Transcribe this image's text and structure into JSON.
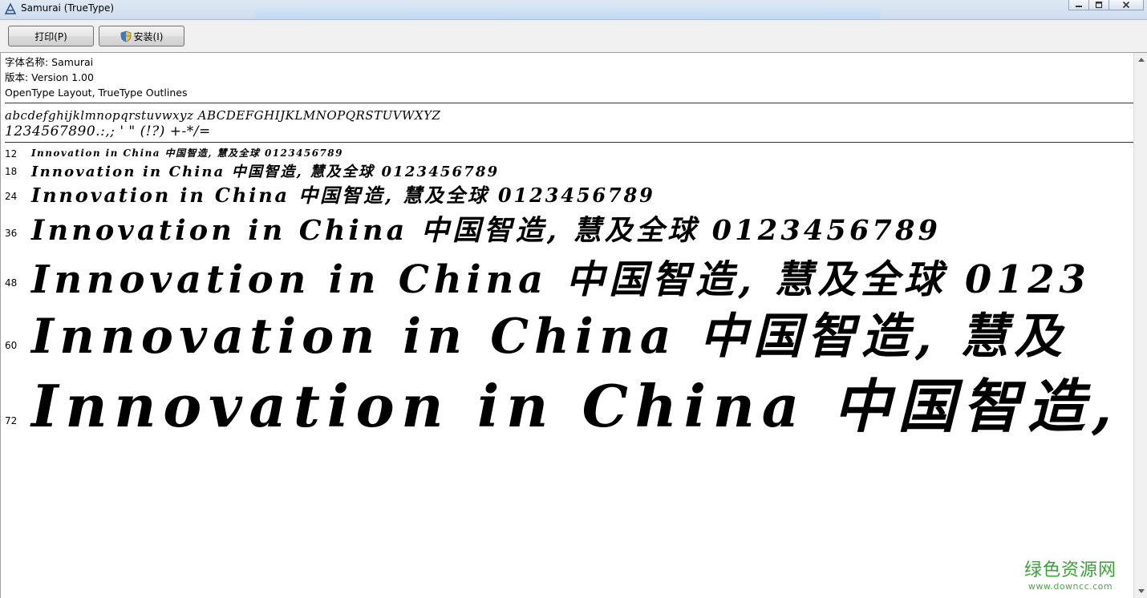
{
  "window": {
    "title": "Samurai (TrueType)"
  },
  "toolbar": {
    "print_label": "打印(P)",
    "install_label": "安装(I)"
  },
  "font_info": {
    "name_line": "字体名称: Samurai",
    "version_line": "版本: Version 1.00",
    "type_line": "OpenType Layout, TrueType Outlines"
  },
  "charset": {
    "line1": "abcdefghijklmnopqrstuvwxyz ABCDEFGHIJKLMNOPQRSTUVWXYZ",
    "line2": "1234567890.:,; ' \" (!?) +-*/="
  },
  "samples": [
    {
      "size": "12",
      "text": "Innovation in China 中国智造, 慧及全球 0123456789"
    },
    {
      "size": "18",
      "text": "Innovation in China 中国智造, 慧及全球 0123456789"
    },
    {
      "size": "24",
      "text": "Innovation in China 中国智造, 慧及全球 0123456789"
    },
    {
      "size": "36",
      "text": "Innovation in China 中国智造, 慧及全球 0123456789"
    },
    {
      "size": "48",
      "text": "Innovation in China 中国智造, 慧及全球 0123"
    },
    {
      "size": "60",
      "text": "Innovation in China 中国智造, 慧及"
    },
    {
      "size": "72",
      "text": "Innovation in China 中国智造,"
    }
  ],
  "watermark": {
    "title": "绿色资源网",
    "url": "www.downcc.com"
  },
  "icons": {
    "app": "font-file-icon",
    "install_shield": "uac-shield-icon"
  },
  "colors": {
    "watermark": "#3aa03a",
    "titlebar": "#dfe9f5"
  }
}
